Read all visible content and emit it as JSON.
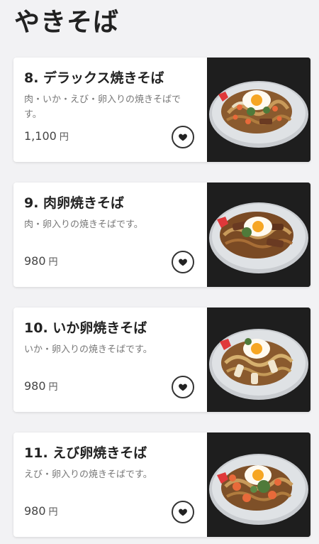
{
  "page": {
    "section_title": "やきそば"
  },
  "menu": {
    "items": [
      {
        "name": "8. デラックス焼きそば",
        "description": "肉・いか・えび・卵入りの焼きそばです。",
        "price": "1,100",
        "currency": "円",
        "photo_icon": "yakisoba-deluxe-photo"
      },
      {
        "name": "9. 肉卵焼きそば",
        "description": "肉・卵入りの焼きそばです。",
        "price": "980",
        "currency": "円",
        "photo_icon": "yakisoba-meat-egg-photo"
      },
      {
        "name": "10. いか卵焼きそば",
        "description": "いか・卵入りの焼きそばです。",
        "price": "980",
        "currency": "円",
        "photo_icon": "yakisoba-squid-egg-photo"
      },
      {
        "name": "11. えび卵焼きそば",
        "description": "えび・卵入りの焼きそばです。",
        "price": "980",
        "currency": "円",
        "photo_icon": "yakisoba-shrimp-egg-photo"
      }
    ]
  },
  "icons": {
    "favorite": "heart-icon"
  },
  "colors": {
    "background": "#f2f2f4",
    "card": "#ffffff",
    "text": "#222222",
    "muted": "#777777",
    "photo_bg": "#1c1c1c"
  }
}
